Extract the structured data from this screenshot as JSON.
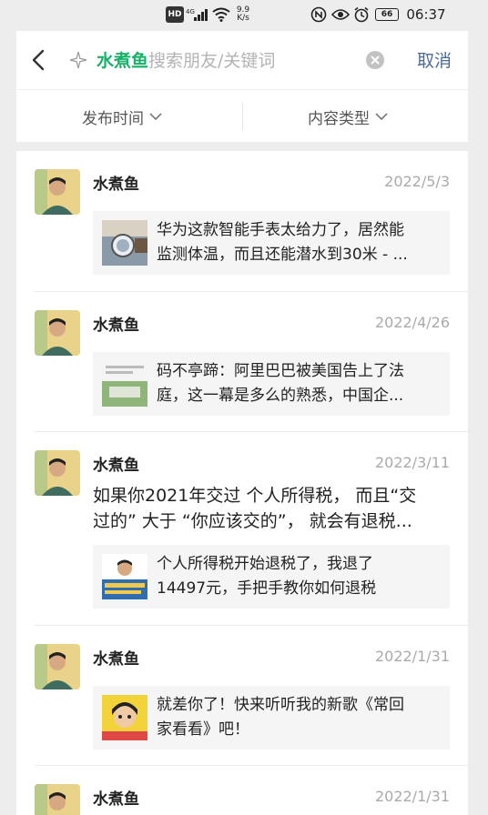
{
  "status_bar": {
    "hd": "HD",
    "network": "⁴ᴳ",
    "speed_value": "9.9",
    "speed_unit": "K/s",
    "battery": "66",
    "time": "06:37"
  },
  "search": {
    "keyword": "水煮鱼",
    "placeholder": "搜索朋友/关键词",
    "cancel_label": "取消"
  },
  "filters": {
    "time_label": "发布时间",
    "type_label": "内容类型"
  },
  "results": [
    {
      "author": "水煮鱼",
      "date": "2022/5/3",
      "body": [],
      "card": [
        "华为这款智能手表太给力了，居然能",
        "监测体温，而且还能潜水到30米 - ..."
      ]
    },
    {
      "author": "水煮鱼",
      "date": "2022/4/26",
      "body": [],
      "card": [
        "码不亭蹄：阿里巴巴被美国告上了法",
        "庭，这一幕是多么的熟悉，中国企..."
      ]
    },
    {
      "author": "水煮鱼",
      "date": "2022/3/11",
      "body": [
        "如果你2021年交过 个人所得税， 而且“交",
        "过的” 大于 “你应该交的”， 就会有退税..."
      ],
      "card": [
        "个人所得税开始退税了，我退了",
        "14497元，手把手教你如何退税"
      ]
    },
    {
      "author": "水煮鱼",
      "date": "2022/1/31",
      "body": [],
      "card": [
        "就差你了！快来听听我的新歌《常回",
        "家看看》吧！"
      ]
    },
    {
      "author": "水煮鱼",
      "date": "2022/1/31",
      "body": [],
      "card": []
    }
  ],
  "icons": {
    "back": "back-arrow-icon",
    "sparkle": "sparkle-icon",
    "clear": "clear-icon",
    "chevron": "chevron-down-icon"
  },
  "colors": {
    "keyword": "#17b169",
    "cancel": "#4a6b95",
    "background": "#ededed"
  }
}
